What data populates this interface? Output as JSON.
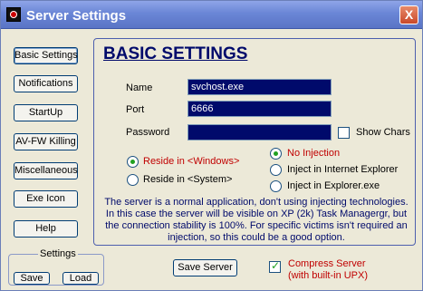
{
  "window": {
    "title": "Server Settings",
    "close_label": "X"
  },
  "sidebar": {
    "items": [
      {
        "label": "Basic Settings"
      },
      {
        "label": "Notifications"
      },
      {
        "label": "StartUp"
      },
      {
        "label": "AV-FW Killing"
      },
      {
        "label": "Miscellaneous"
      },
      {
        "label": "Exe Icon"
      },
      {
        "label": "Help"
      }
    ],
    "active": "Basic Settings"
  },
  "settings_group": {
    "caption": "Settings",
    "save_label": "Save",
    "load_label": "Load"
  },
  "panel": {
    "title": "BASIC SETTINGS",
    "name_label": "Name",
    "name_value": "svchost.exe",
    "port_label": "Port",
    "port_value": "6666",
    "password_label": "Password",
    "password_value": "",
    "show_chars_label": "Show Chars",
    "show_chars_checked": false,
    "reside_windows_label": "Reside in <Windows>",
    "reside_system_label": "Reside in <System>",
    "reside_selected": "Reside in <Windows>",
    "no_injection_label": "No Injection",
    "inject_ie_label": "Inject in Internet Explorer",
    "inject_explorer_label": "Inject in Explorer.exe",
    "injection_selected": "No Injection",
    "description": "The server is a normal application, don't using injecting technologies. In this case the server will be visible on XP (2k) Task Managergr, but the connection stability is 100%. For specific victims isn't required an injection, so this could be a good option."
  },
  "footer": {
    "save_server_label": "Save Server",
    "compress_label_line1": "Compress Server",
    "compress_label_line2": "(with built-in UPX)",
    "compress_checked": true
  },
  "colors": {
    "accent": "#000a6b",
    "highlight": "#c00000",
    "check": "#21a121"
  }
}
